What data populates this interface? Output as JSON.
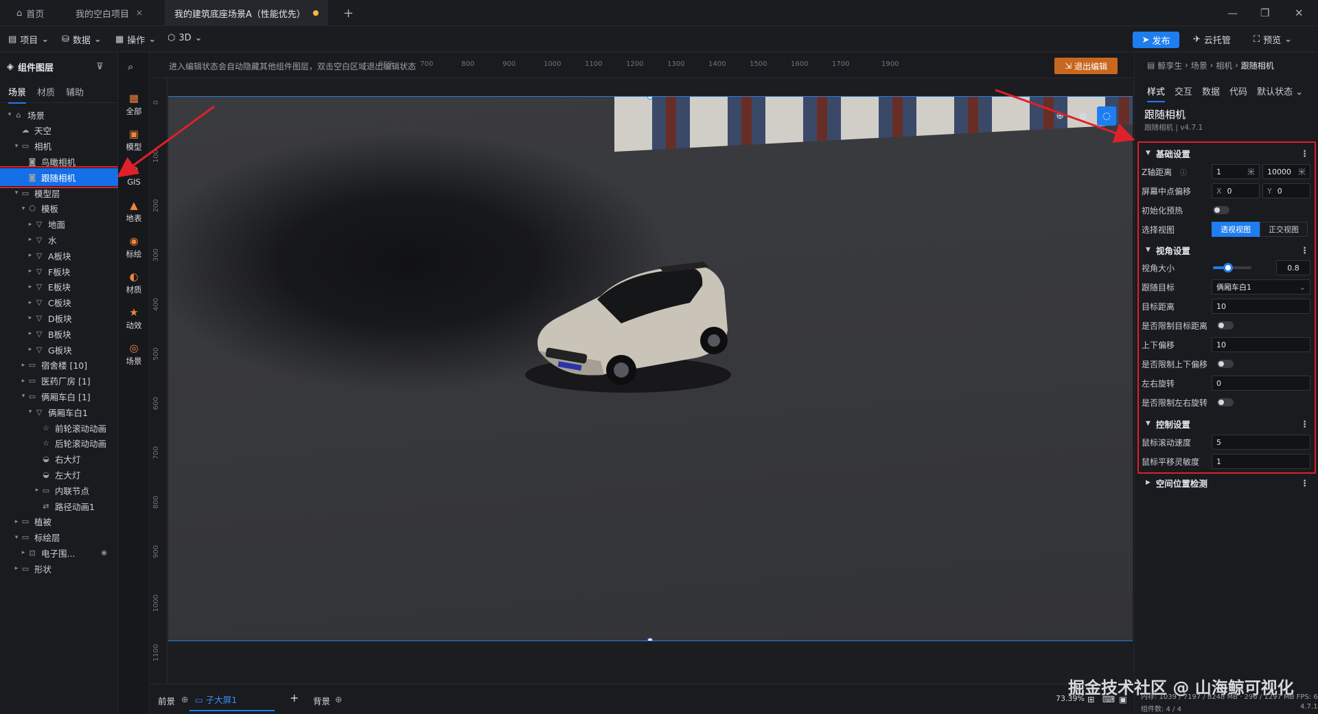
{
  "tabs": [
    {
      "label": "首页"
    },
    {
      "label": "我的空白项目"
    },
    {
      "label": "我的建筑底座场景A（性能优先）"
    }
  ],
  "toolbar": {
    "project": "项目",
    "data": "数据",
    "operate": "操作",
    "mode": "3D",
    "publish": "发布",
    "cloud": "云托管",
    "preview": "预览"
  },
  "left": {
    "title": "组件图层",
    "tabs": [
      "场景",
      "材质",
      "辅助"
    ],
    "tree": [
      {
        "label": "场景",
        "depth": 0,
        "caret": "▾",
        "icon": "scene-icon"
      },
      {
        "label": "天空",
        "depth": 1,
        "caret": "",
        "icon": "sky-icon"
      },
      {
        "label": "相机",
        "depth": 1,
        "caret": "▾",
        "icon": "folder-icon"
      },
      {
        "label": "鸟瞰相机",
        "depth": 2,
        "caret": "",
        "icon": "camera-icon"
      },
      {
        "label": "跟随相机",
        "depth": 2,
        "caret": "",
        "icon": "camera-icon",
        "selected": true
      },
      {
        "label": "模型层",
        "depth": 1,
        "caret": "▾",
        "icon": "folder-icon"
      },
      {
        "label": "模板",
        "depth": 2,
        "caret": "▾",
        "icon": "cube-icon"
      },
      {
        "label": "地面",
        "depth": 3,
        "caret": "▸",
        "icon": "mesh-icon"
      },
      {
        "label": "水",
        "depth": 3,
        "caret": "▸",
        "icon": "mesh-icon"
      },
      {
        "label": "A板块",
        "depth": 3,
        "caret": "▸",
        "icon": "mesh-icon"
      },
      {
        "label": "F板块",
        "depth": 3,
        "caret": "▸",
        "icon": "mesh-icon"
      },
      {
        "label": "E板块",
        "depth": 3,
        "caret": "▸",
        "icon": "mesh-icon"
      },
      {
        "label": "C板块",
        "depth": 3,
        "caret": "▸",
        "icon": "mesh-icon"
      },
      {
        "label": "D板块",
        "depth": 3,
        "caret": "▸",
        "icon": "mesh-icon"
      },
      {
        "label": "B板块",
        "depth": 3,
        "caret": "▸",
        "icon": "mesh-icon"
      },
      {
        "label": "G板块",
        "depth": 3,
        "caret": "▸",
        "icon": "mesh-icon"
      },
      {
        "label": "宿舍楼 [10]",
        "depth": 2,
        "caret": "▸",
        "icon": "folder-icon"
      },
      {
        "label": "医药厂房 [1]",
        "depth": 2,
        "caret": "▸",
        "icon": "folder-icon"
      },
      {
        "label": "俩厢车白 [1]",
        "depth": 2,
        "caret": "▾",
        "icon": "folder-icon"
      },
      {
        "label": "俩厢车白1",
        "depth": 3,
        "caret": "▾",
        "icon": "mesh-icon"
      },
      {
        "label": "前轮滚动动画",
        "depth": 4,
        "caret": "",
        "icon": "animation-icon"
      },
      {
        "label": "后轮滚动动画",
        "depth": 4,
        "caret": "",
        "icon": "animation-icon"
      },
      {
        "label": "右大灯",
        "depth": 4,
        "caret": "",
        "icon": "light-icon"
      },
      {
        "label": "左大灯",
        "depth": 4,
        "caret": "",
        "icon": "light-icon"
      },
      {
        "label": "内联节点",
        "depth": 4,
        "caret": "▸",
        "icon": "folder-icon"
      },
      {
        "label": "路径动画1",
        "depth": 4,
        "caret": "",
        "icon": "path-icon"
      },
      {
        "label": "植被",
        "depth": 1,
        "caret": "▸",
        "icon": "folder-icon"
      },
      {
        "label": "标绘层",
        "depth": 1,
        "caret": "▾",
        "icon": "folder-icon"
      },
      {
        "label": "电子围...",
        "depth": 2,
        "caret": "▸",
        "icon": "fence-icon"
      },
      {
        "label": "形状",
        "depth": 1,
        "caret": "▸",
        "icon": "folder-icon"
      }
    ]
  },
  "categories": [
    "全部",
    "模型",
    "GIS",
    "地表",
    "标绘",
    "材质",
    "动效",
    "场景"
  ],
  "viewport": {
    "hint": "进入编辑状态会自动隐藏其他组件图层，双击空白区域退出编辑状态",
    "exit": "退出编辑",
    "hticks": [
      "600",
      "700",
      "800",
      "900",
      "1000",
      "1100",
      "1200",
      "1300",
      "1400",
      "1500",
      "1600",
      "1700",
      "1900"
    ],
    "vticks": [
      "0",
      "100",
      "200",
      "300",
      "400",
      "500",
      "600",
      "700",
      "800",
      "900",
      "1000",
      "1100"
    ]
  },
  "bottom": {
    "front": "前景",
    "screen": "子大屏1",
    "back": "背景",
    "zoom": "73.39%"
  },
  "right": {
    "breadcrumb": [
      "鲸孪生",
      "场景",
      "相机",
      "跟随相机"
    ],
    "tabs": [
      "样式",
      "交互",
      "数据",
      "代码"
    ],
    "state": "默认状态",
    "component": {
      "name": "跟随相机",
      "sub": "跟随相机 | v4.7.1"
    },
    "basic": {
      "title": "基础设置",
      "zaxis_label": "Z轴距离",
      "z_min": "1",
      "z_max": "10000",
      "unit": "米",
      "center_label": "屏幕中点偏移",
      "x": "0",
      "y": "0",
      "preheat_label": "初始化预热",
      "view_label": "选择视图",
      "view_opts": [
        "透视视图",
        "正交视图"
      ]
    },
    "angle": {
      "title": "视角设置",
      "fov_label": "视角大小",
      "fov": "0.8",
      "fov_fraction": 0.4,
      "target_label": "跟随目标",
      "target": "俩厢车白1",
      "dist_label": "目标距离",
      "dist": "10",
      "limit_dist_label": "是否限制目标距离",
      "updown_label": "上下偏移",
      "updown": "10",
      "limit_updown_label": "是否限制上下偏移",
      "rotate_label": "左右旋转",
      "rotate": "0",
      "limit_rotate_label": "是否限制左右旋转"
    },
    "control": {
      "title": "控制设置",
      "wheel_label": "鼠标滚动速度",
      "wheel": "5",
      "pan_label": "鼠标平移灵敏度",
      "pan": "1"
    },
    "space": {
      "title": "空间位置检测"
    }
  },
  "status": {
    "mem": "内存: 1039 / 7197 / 8248 MB · 296 / 1297 MB FPS: 60",
    "count": "组件数: 4 / 4",
    "version": "4.7.1"
  },
  "watermark": "掘金技术社区 @ 山海鲸可视化",
  "colors": {
    "accent": "#1e7ef0",
    "highlight": "#e0202a",
    "exit": "#c8671f"
  }
}
